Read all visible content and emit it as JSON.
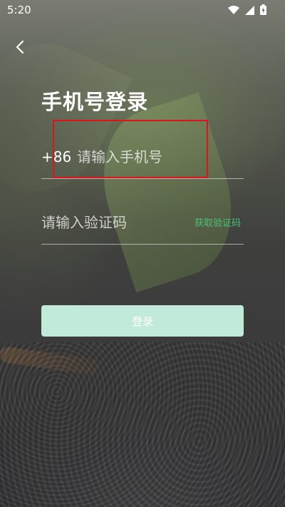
{
  "status_bar": {
    "time": "5:20",
    "icons": [
      "wifi-icon",
      "signal-icon",
      "battery-icon"
    ]
  },
  "nav": {
    "back_icon": "chevron-left-icon"
  },
  "page": {
    "title": "手机号登录"
  },
  "phone_field": {
    "country_code": "+86",
    "value": "",
    "placeholder": "请输入手机号"
  },
  "code_field": {
    "value": "",
    "placeholder": "请输入验证码",
    "get_code_label": "获取验证码"
  },
  "login_button": {
    "label": "登录"
  },
  "colors": {
    "accent": "#49c178",
    "button_bg": "#c2eadb",
    "highlight": "#e0121b"
  }
}
